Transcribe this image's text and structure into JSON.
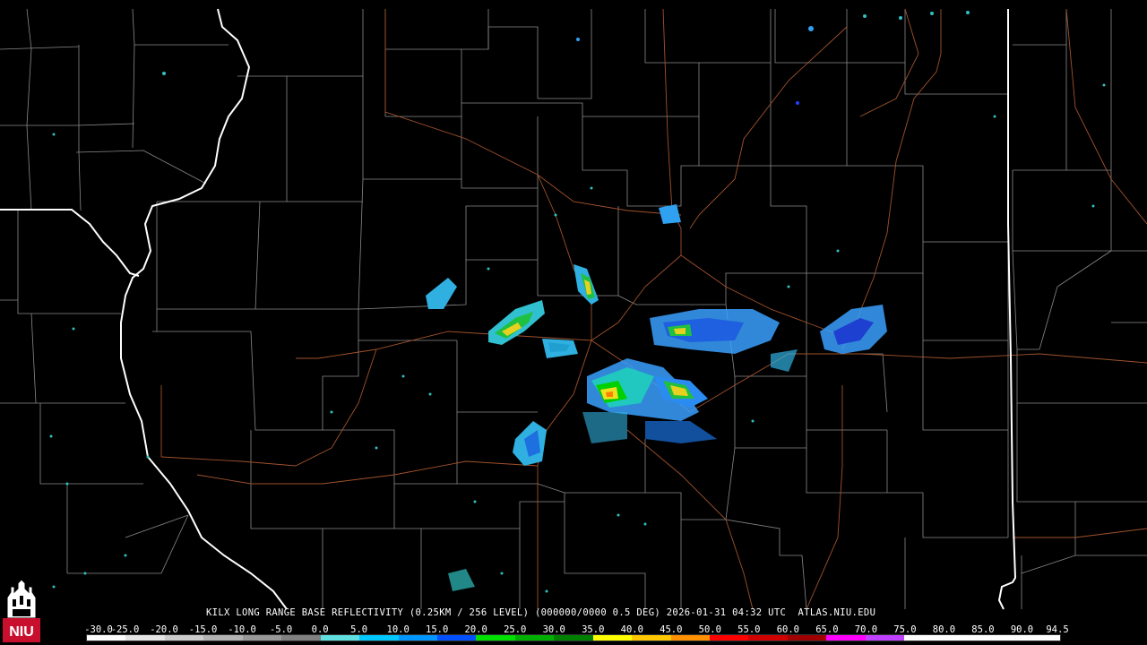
{
  "caption": {
    "station": "KILX",
    "product": "LONG RANGE BASE REFLECTIVITY",
    "resolution": "(0.25KM / 256 LEVEL)",
    "elevation": "(000000/0000 0.5 DEG)",
    "date": "2026-01-31",
    "time": "04:32 UTC",
    "source": "ATLAS.NIU.EDU"
  },
  "logo": {
    "text": "NIU",
    "icon": "niu-castle-logo-icon"
  },
  "scale": {
    "labels": [
      "-30.0",
      "-25.0",
      "-20.0",
      "-15.0",
      "-10.0",
      "-5.0",
      "0.0",
      "5.0",
      "10.0",
      "15.0",
      "20.0",
      "25.0",
      "30.0",
      "35.0",
      "40.0",
      "45.0",
      "50.0",
      "55.0",
      "60.0",
      "65.0",
      "70.0",
      "75.0",
      "80.0",
      "85.0",
      "90.0",
      "94.5"
    ],
    "colors": [
      "#ffffff",
      "#e6e6e6",
      "#cccccc",
      "#b3b3b3",
      "#999999",
      "#808080",
      "#60e0e0",
      "#00c8ff",
      "#0096ff",
      "#0050ff",
      "#00e000",
      "#00b000",
      "#008000",
      "#ffff00",
      "#ffc800",
      "#ff9000",
      "#ff0000",
      "#d00000",
      "#a00000",
      "#ff00ff",
      "#c040ff",
      "#ffffff",
      "#ffffff",
      "#ffffff",
      "#ffffff"
    ]
  },
  "colors": {
    "background": "#000000",
    "county_lines": "#8a8a8a",
    "state_lines": "#ffffff",
    "highways": "#a0522d"
  }
}
